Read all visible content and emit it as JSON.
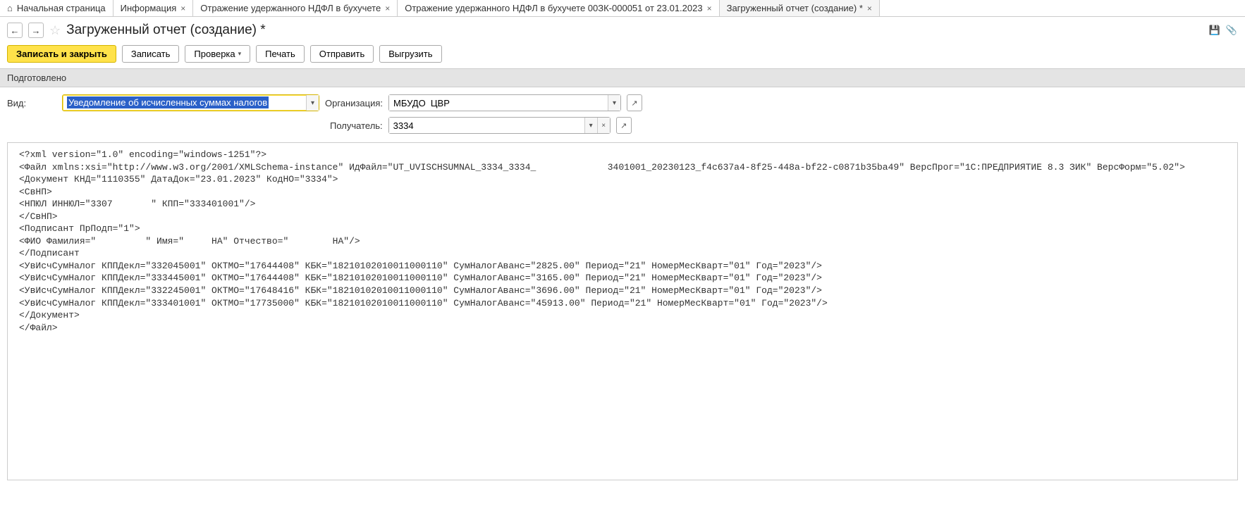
{
  "tabs": [
    {
      "label": "Начальная страница",
      "closable": false,
      "home": true
    },
    {
      "label": "Информация",
      "closable": true
    },
    {
      "label": "Отражение удержанного НДФЛ в бухучете",
      "closable": true
    },
    {
      "label": "Отражение удержанного НДФЛ в бухучете 00ЗК-000051 от 23.01.2023",
      "closable": true
    },
    {
      "label": "Загруженный отчет (создание) *",
      "closable": true,
      "active": true
    }
  ],
  "nav": {
    "back": "←",
    "forward": "→"
  },
  "page_title": "Загруженный отчет (создание) *",
  "toolbar": {
    "write_close": "Записать и закрыть",
    "write": "Записать",
    "check": "Проверка",
    "print": "Печать",
    "send": "Отправить",
    "export": "Выгрузить"
  },
  "status": "Подготовлено",
  "form": {
    "vid_label": "Вид:",
    "vid_value": "Уведомление об исчисленных суммах налогов",
    "org_label": "Организация:",
    "org_value": "МБУДО  ЦВР",
    "recipient_label": "Получатель:",
    "recipient_value": "3334"
  },
  "xml_content": "<?xml version=\"1.0\" encoding=\"windows-1251\"?>\n<Файл xmlns:xsi=\"http://www.w3.org/2001/XMLSchema-instance\" ИдФайл=\"UT_UVISCHSUMNAL_3334_3334_             3401001_20230123_f4c637a4-8f25-448a-bf22-c0871b35ba49\" ВерсПрог=\"1С:ПРЕДПРИЯТИЕ 8.3 ЗИК\" ВерсФорм=\"5.02\">\n<Документ КНД=\"1110355\" ДатаДок=\"23.01.2023\" КодНО=\"3334\">\n<СвНП>\n<НПЮЛ ИННЮЛ=\"3307       \" КПП=\"333401001\"/>\n</СвНП>\n<Подписант ПрПодп=\"1\">\n<ФИО Фамилия=\"         \" Имя=\"     НА\" Отчество=\"        НА\"/>\n</Подписант\n<УвИсчСумНалог КППДекл=\"332045001\" ОКТМО=\"17644408\" КБК=\"18210102010011000110\" СумНалогАванс=\"2825.00\" Период=\"21\" НомерМесКварт=\"01\" Год=\"2023\"/>\n<УвИсчСумНалог КППДекл=\"333445001\" ОКТМО=\"17644408\" КБК=\"18210102010011000110\" СумНалогАванс=\"3165.00\" Период=\"21\" НомерМесКварт=\"01\" Год=\"2023\"/>\n<УвИсчСумНалог КППДекл=\"332245001\" ОКТМО=\"17648416\" КБК=\"18210102010011000110\" СумНалогАванс=\"3696.00\" Период=\"21\" НомерМесКварт=\"01\" Год=\"2023\"/>\n<УвИсчСумНалог КППДекл=\"333401001\" ОКТМО=\"17735000\" КБК=\"18210102010011000110\" СумНалогАванс=\"45913.00\" Период=\"21\" НомерМесКварт=\"01\" Год=\"2023\"/>\n</Документ>\n</Файл>"
}
